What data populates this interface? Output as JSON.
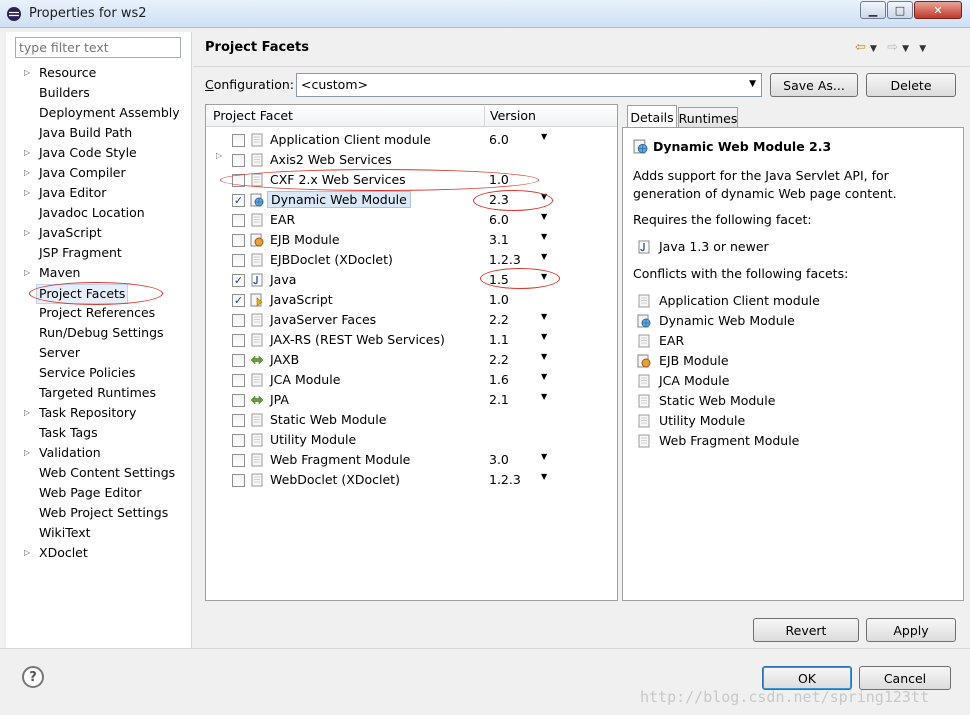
{
  "window": {
    "title": "Properties for ws2"
  },
  "filter": {
    "placeholder": "type filter text"
  },
  "nav": [
    {
      "label": "Resource",
      "expandable": true
    },
    {
      "label": "Builders",
      "expandable": false
    },
    {
      "label": "Deployment Assembly",
      "expandable": false
    },
    {
      "label": "Java Build Path",
      "expandable": false
    },
    {
      "label": "Java Code Style",
      "expandable": true
    },
    {
      "label": "Java Compiler",
      "expandable": true
    },
    {
      "label": "Java Editor",
      "expandable": true
    },
    {
      "label": "Javadoc Location",
      "expandable": false
    },
    {
      "label": "JavaScript",
      "expandable": true
    },
    {
      "label": "JSP Fragment",
      "expandable": false
    },
    {
      "label": "Maven",
      "expandable": true
    },
    {
      "label": "Project Facets",
      "expandable": false,
      "selected": true
    },
    {
      "label": "Project References",
      "expandable": false
    },
    {
      "label": "Run/Debug Settings",
      "expandable": false
    },
    {
      "label": "Server",
      "expandable": false
    },
    {
      "label": "Service Policies",
      "expandable": false
    },
    {
      "label": "Targeted Runtimes",
      "expandable": false
    },
    {
      "label": "Task Repository",
      "expandable": true
    },
    {
      "label": "Task Tags",
      "expandable": false
    },
    {
      "label": "Validation",
      "expandable": true
    },
    {
      "label": "Web Content Settings",
      "expandable": false
    },
    {
      "label": "Web Page Editor",
      "expandable": false
    },
    {
      "label": "Web Project Settings",
      "expandable": false
    },
    {
      "label": "WikiText",
      "expandable": false
    },
    {
      "label": "XDoclet",
      "expandable": true
    }
  ],
  "page": {
    "title": "Project Facets"
  },
  "config": {
    "label": "Configuration:",
    "value": "<custom>",
    "save_as": "Save As...",
    "delete": "Delete"
  },
  "facets": {
    "col_facet": "Project Facet",
    "col_version": "Version",
    "rows": [
      {
        "label": "Application Client module",
        "version": "6.0",
        "checked": false,
        "dropdown": true,
        "icon": "page"
      },
      {
        "label": "Axis2 Web Services",
        "version": "",
        "checked": false,
        "dropdown": false,
        "icon": "page",
        "expandable": true
      },
      {
        "label": "CXF 2.x Web Services",
        "version": "1.0",
        "checked": false,
        "dropdown": false,
        "icon": "page"
      },
      {
        "label": "Dynamic Web Module",
        "version": "2.3",
        "checked": true,
        "dropdown": true,
        "icon": "globe",
        "selected": true
      },
      {
        "label": "EAR",
        "version": "6.0",
        "checked": false,
        "dropdown": true,
        "icon": "page"
      },
      {
        "label": "EJB Module",
        "version": "3.1",
        "checked": false,
        "dropdown": true,
        "icon": "bean"
      },
      {
        "label": "EJBDoclet (XDoclet)",
        "version": "1.2.3",
        "checked": false,
        "dropdown": true,
        "icon": "page"
      },
      {
        "label": "Java",
        "version": "1.5",
        "checked": true,
        "dropdown": true,
        "icon": "java"
      },
      {
        "label": "JavaScript",
        "version": "1.0",
        "checked": true,
        "dropdown": false,
        "icon": "js"
      },
      {
        "label": "JavaServer Faces",
        "version": "2.2",
        "checked": false,
        "dropdown": true,
        "icon": "page"
      },
      {
        "label": "JAX-RS (REST Web Services)",
        "version": "1.1",
        "checked": false,
        "dropdown": true,
        "icon": "page"
      },
      {
        "label": "JAXB",
        "version": "2.2",
        "checked": false,
        "dropdown": true,
        "icon": "arrows"
      },
      {
        "label": "JCA Module",
        "version": "1.6",
        "checked": false,
        "dropdown": true,
        "icon": "page"
      },
      {
        "label": "JPA",
        "version": "2.1",
        "checked": false,
        "dropdown": true,
        "icon": "arrows"
      },
      {
        "label": "Static Web Module",
        "version": "",
        "checked": false,
        "dropdown": false,
        "icon": "page"
      },
      {
        "label": "Utility Module",
        "version": "",
        "checked": false,
        "dropdown": false,
        "icon": "page"
      },
      {
        "label": "Web Fragment Module",
        "version": "3.0",
        "checked": false,
        "dropdown": true,
        "icon": "page"
      },
      {
        "label": "WebDoclet (XDoclet)",
        "version": "1.2.3",
        "checked": false,
        "dropdown": true,
        "icon": "page"
      }
    ]
  },
  "details": {
    "tab_details": "Details",
    "tab_runtimes": "Runtimes",
    "heading": "Dynamic Web Module 2.3",
    "desc_line1": "Adds support for the Java Servlet API, for",
    "desc_line2": "generation of dynamic Web page content.",
    "requires_label": "Requires the following facet:",
    "requires": [
      {
        "label": "Java 1.3 or newer",
        "icon": "java"
      }
    ],
    "conflicts_label": "Conflicts with the following facets:",
    "conflicts": [
      {
        "label": "Application Client module",
        "icon": "page"
      },
      {
        "label": "Dynamic Web Module",
        "icon": "globe"
      },
      {
        "label": "EAR",
        "icon": "page"
      },
      {
        "label": "EJB Module",
        "icon": "bean"
      },
      {
        "label": "JCA Module",
        "icon": "page"
      },
      {
        "label": "Static Web Module",
        "icon": "page"
      },
      {
        "label": "Utility Module",
        "icon": "page"
      },
      {
        "label": "Web Fragment Module",
        "icon": "page"
      }
    ]
  },
  "buttons": {
    "revert": "Revert",
    "apply": "Apply",
    "ok": "OK",
    "cancel": "Cancel"
  },
  "watermark": "http://blog.csdn.net/spring123tt",
  "colors": {
    "annotation": "#d9342b",
    "selection": "#dbe8f8"
  }
}
